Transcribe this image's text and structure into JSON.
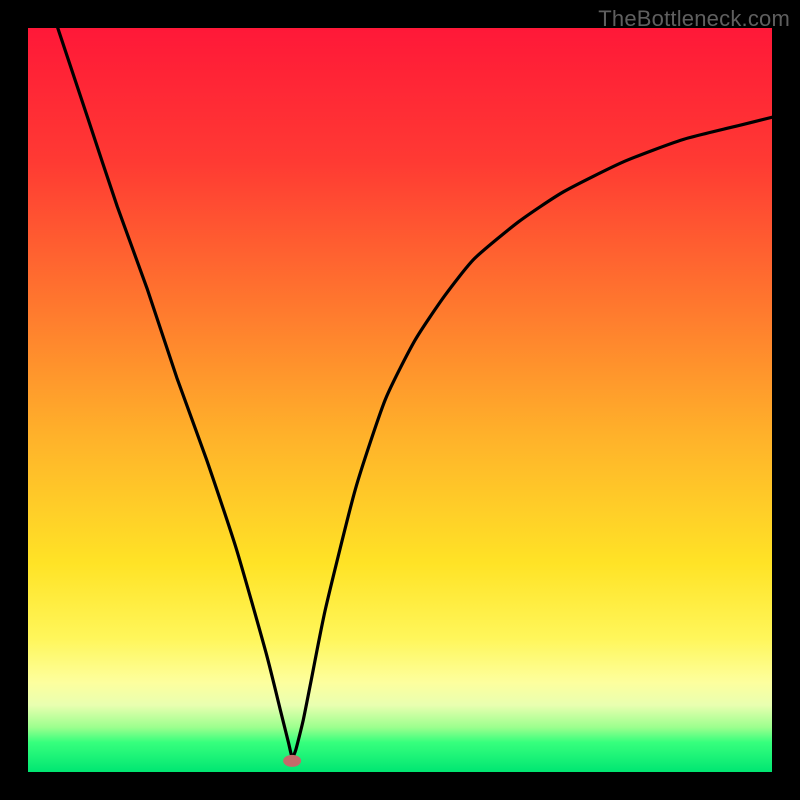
{
  "watermark": {
    "text": "TheBottleneck.com"
  },
  "chart_data": {
    "type": "line",
    "title": "",
    "xlabel": "",
    "ylabel": "",
    "xlim": [
      0,
      100
    ],
    "ylim": [
      0,
      100
    ],
    "grid": false,
    "series": [
      {
        "name": "curve",
        "color": "#000000",
        "x": [
          4,
          8,
          12,
          16,
          20,
          24,
          28,
          32,
          34,
          35,
          35.5,
          36,
          37,
          38,
          40,
          44,
          48,
          52,
          56,
          60,
          66,
          72,
          80,
          88,
          96,
          100
        ],
        "values": [
          100,
          88,
          76,
          65,
          53,
          42,
          30,
          16,
          8,
          4,
          2,
          3,
          7,
          12,
          22,
          38,
          50,
          58,
          64,
          69,
          74,
          78,
          82,
          85,
          87,
          88
        ]
      }
    ],
    "marker": {
      "x": 35.5,
      "y": 1.5,
      "color": "#c46a6a"
    },
    "background_gradient": {
      "stops": [
        {
          "pos": 0,
          "color": "#ff1838"
        },
        {
          "pos": 18,
          "color": "#ff3a33"
        },
        {
          "pos": 38,
          "color": "#ff7a2e"
        },
        {
          "pos": 55,
          "color": "#ffb22a"
        },
        {
          "pos": 72,
          "color": "#ffe326"
        },
        {
          "pos": 82,
          "color": "#fff65a"
        },
        {
          "pos": 88,
          "color": "#fdff9e"
        },
        {
          "pos": 91,
          "color": "#e9ffb0"
        },
        {
          "pos": 94,
          "color": "#9cff8e"
        },
        {
          "pos": 96,
          "color": "#37ff7d"
        },
        {
          "pos": 100,
          "color": "#00e672"
        }
      ]
    }
  }
}
